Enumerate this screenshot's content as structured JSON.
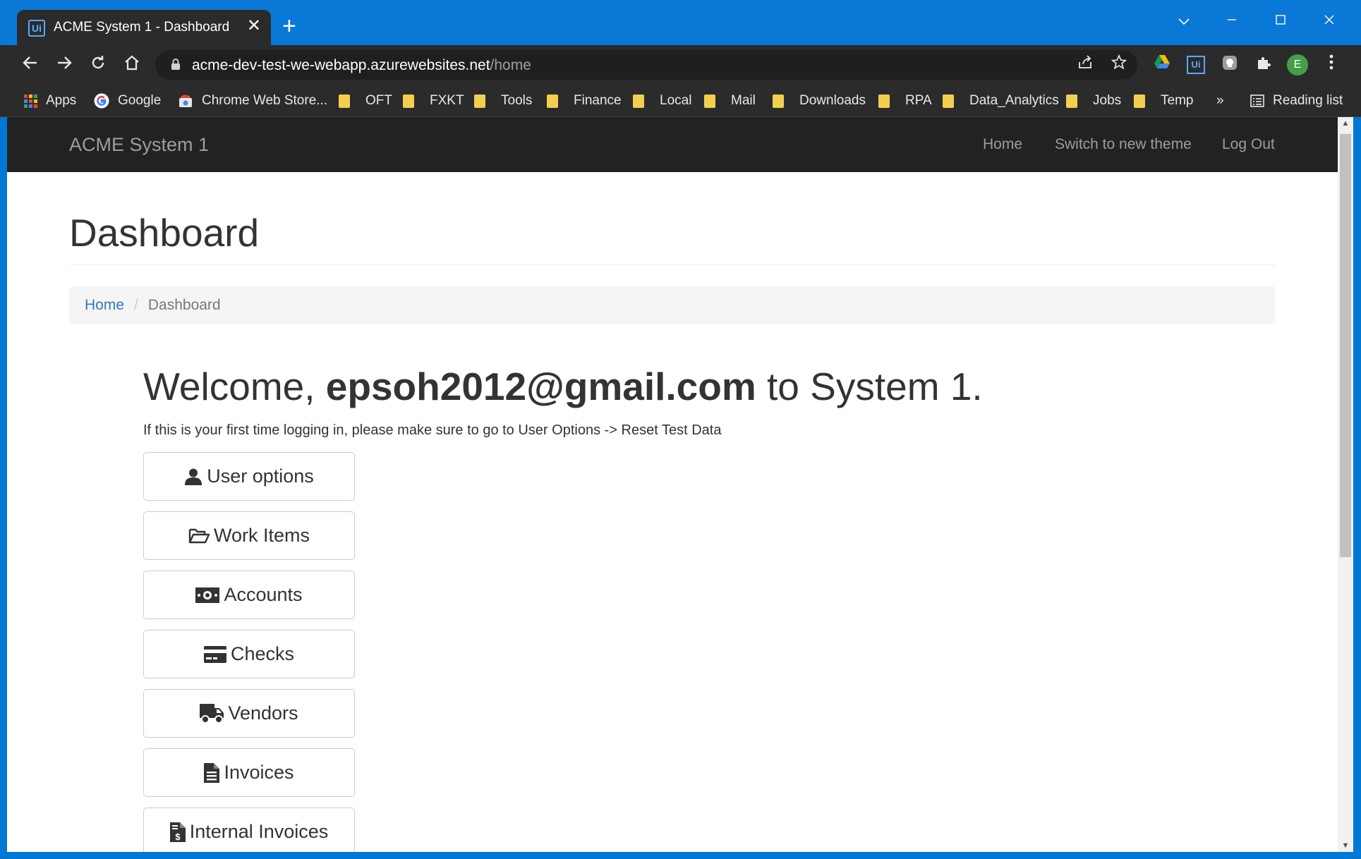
{
  "browser": {
    "tab_title": "ACME System 1 - Dashboard",
    "tab_favicon_text": "Ui",
    "tab_close": "✕",
    "new_tab": "+",
    "url_host": "acme-dev-test-we-webapp.azurewebsites.net",
    "url_path": "/home",
    "profile_initial": "E",
    "bookmarks": [
      {
        "label": "Apps"
      },
      {
        "label": "Google"
      },
      {
        "label": "Chrome Web Store..."
      },
      {
        "label": "OFT"
      },
      {
        "label": "FXKT"
      },
      {
        "label": "Tools"
      },
      {
        "label": "Finance"
      },
      {
        "label": "Local"
      },
      {
        "label": "Mail"
      },
      {
        "label": "Downloads"
      },
      {
        "label": "RPA"
      },
      {
        "label": "Data_Analytics"
      },
      {
        "label": "Jobs"
      },
      {
        "label": "Temp"
      }
    ],
    "overflow": "»",
    "reading_list": "Reading list"
  },
  "navbar": {
    "brand": "ACME System 1",
    "links": [
      "Home",
      "Switch to new theme",
      "Log Out"
    ]
  },
  "page": {
    "title": "Dashboard",
    "breadcrumb": {
      "home": "Home",
      "separator": "/",
      "current": "Dashboard"
    },
    "welcome_prefix": "Welcome, ",
    "welcome_email": "epsoh2012@gmail.com",
    "welcome_suffix": " to System 1.",
    "hint": "If this is your first time logging in, please make sure to go to User Options -> Reset Test Data"
  },
  "menu": [
    {
      "label": "User options",
      "icon": "user-icon"
    },
    {
      "label": "Work Items",
      "icon": "folder-open-icon"
    },
    {
      "label": "Accounts",
      "icon": "money-icon"
    },
    {
      "label": "Checks",
      "icon": "credit-card-icon"
    },
    {
      "label": "Vendors",
      "icon": "truck-icon"
    },
    {
      "label": "Invoices",
      "icon": "document-icon"
    },
    {
      "label": "Internal Invoices",
      "icon": "invoice-dollar-icon"
    }
  ],
  "colors": {
    "titlebar": "#0a78d6",
    "chrome_dark": "#2b2b2b",
    "navbar": "#222222",
    "link": "#337ab7",
    "bookmark_folder": "#f2cf4f"
  }
}
